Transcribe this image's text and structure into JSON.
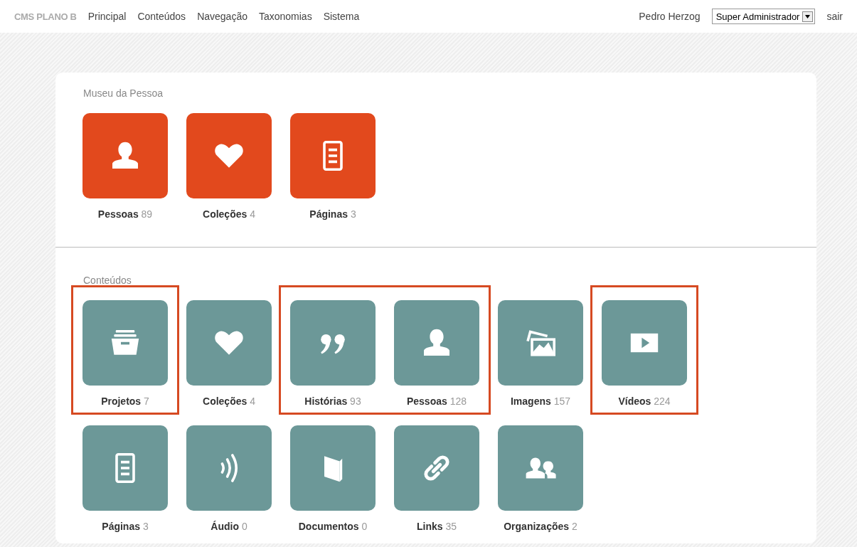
{
  "topbar": {
    "brand": "CMS PLANO B",
    "nav": [
      {
        "label": "Principal"
      },
      {
        "label": "Conteúdos"
      },
      {
        "label": "Navegação"
      },
      {
        "label": "Taxonomias"
      },
      {
        "label": "Sistema"
      }
    ],
    "user": "Pedro Herzog",
    "role": "Super Administrador",
    "logout": "sair"
  },
  "sections": [
    {
      "title": "Museu da Pessoa",
      "color": "#e2491d",
      "rows": [
        [
          {
            "kind": "person",
            "label": "Pessoas",
            "count": "89",
            "highlighted": false
          },
          {
            "kind": "heart",
            "label": "Coleções",
            "count": "4",
            "highlighted": false
          },
          {
            "kind": "page",
            "label": "Páginas",
            "count": "3",
            "highlighted": false
          }
        ]
      ]
    },
    {
      "title": "Conteúdos",
      "color": "#6c9898",
      "rows": [
        [
          {
            "kind": "archive",
            "label": "Projetos",
            "count": "7",
            "highlighted": true
          },
          {
            "kind": "heart",
            "label": "Coleções",
            "count": "4",
            "highlighted": false
          },
          {
            "kind": "quote",
            "label": "Histórias",
            "count": "93",
            "highlighted": true
          },
          {
            "kind": "person",
            "label": "Pessoas",
            "count": "128",
            "highlighted": true
          },
          {
            "kind": "images",
            "label": "Imagens",
            "count": "157",
            "highlighted": false
          },
          {
            "kind": "video",
            "label": "Vídeos",
            "count": "224",
            "highlighted": true
          }
        ],
        [
          {
            "kind": "page",
            "label": "Páginas",
            "count": "3",
            "highlighted": false
          },
          {
            "kind": "audio",
            "label": "Áudio",
            "count": "0",
            "highlighted": false
          },
          {
            "kind": "book",
            "label": "Documentos",
            "count": "0",
            "highlighted": false
          },
          {
            "kind": "link",
            "label": "Links",
            "count": "35",
            "highlighted": false
          },
          {
            "kind": "group",
            "label": "Organizações",
            "count": "2",
            "highlighted": false
          }
        ]
      ]
    }
  ]
}
